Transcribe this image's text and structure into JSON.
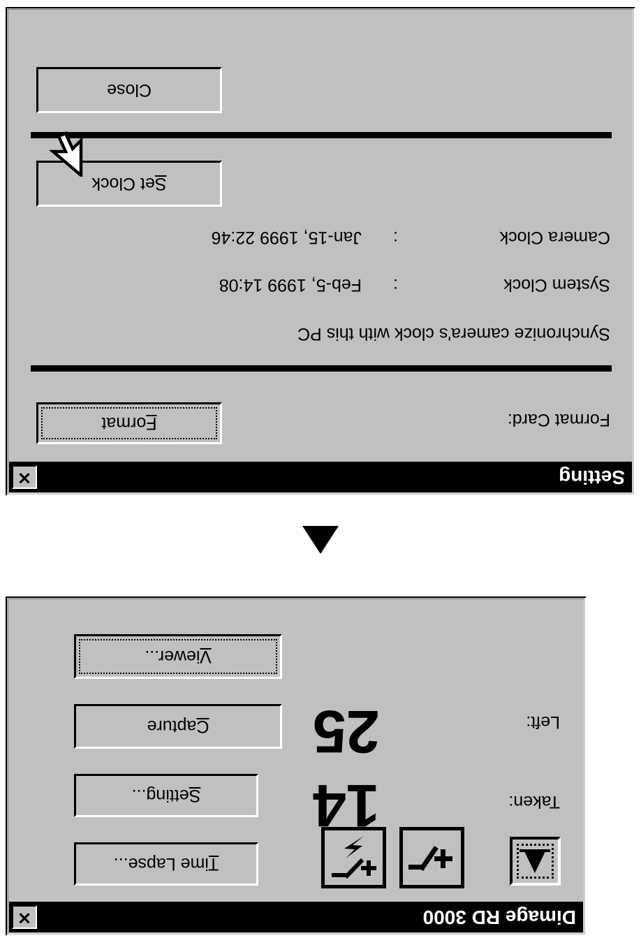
{
  "settings_dialog": {
    "title": "Setting",
    "close_icon": "close-x-icon",
    "close_button_label": "Close",
    "set_clock_button": {
      "mnemonic": "S",
      "rest": "et Clock"
    },
    "rows": [
      {
        "label": "Camera Clock",
        "separator": ":",
        "value": "Jan-15, 1999 22:46"
      },
      {
        "label": "System Clock",
        "separator": ":",
        "value": "Feb-5, 1999 14:08"
      }
    ],
    "description": "Synchronize camera's clock with this PC",
    "format_card_label": "Format Card:",
    "format_button": {
      "mnemonic": "F",
      "rest": "ormat"
    },
    "cursor_icon": "mouse-arrow-cursor"
  },
  "pointer_triangle": {
    "icon": "triangle-up-icon"
  },
  "main_dialog": {
    "title": "Dimage RD 3000",
    "close_icon": "close-x-icon",
    "toolbar": [
      {
        "icon": "histogram-icon",
        "state": "focused"
      },
      {
        "icon": "exposure-compensation-icon",
        "state": "normal"
      },
      {
        "icon": "flash-compensation-icon",
        "state": "normal"
      }
    ],
    "counters": [
      {
        "label": "Taken:",
        "value": "14"
      },
      {
        "label": "Left:",
        "value": "25"
      }
    ],
    "buttons": [
      {
        "mnemonic": "T",
        "rest": "ime Lapse...",
        "focused": false
      },
      {
        "mnemonic": "S",
        "rest": "etting...",
        "focused": false
      },
      {
        "mnemonic": "C",
        "rest": "apture",
        "focused": false
      },
      {
        "mnemonic": "V",
        "rest": "iewer...",
        "focused": true
      }
    ]
  },
  "colors": {
    "face": "#c0c0c0",
    "shadow": "#000000",
    "highlight": "#ffffff",
    "titlebar": "#000000",
    "titlebar_text": "#ffffff",
    "page_bg": "#ffffff"
  }
}
